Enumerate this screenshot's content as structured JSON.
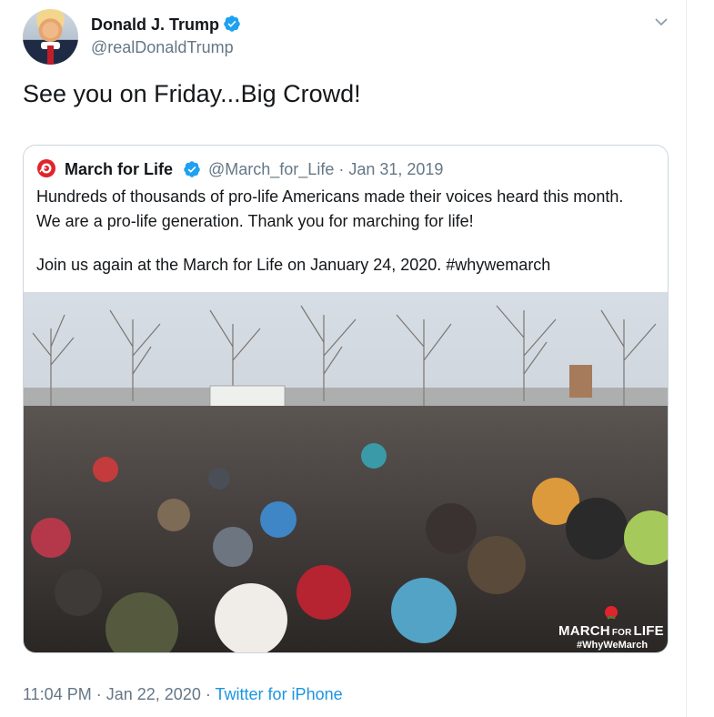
{
  "tweet": {
    "author_name": "Donald J. Trump",
    "author_handle": "@realDonaldTrump",
    "text": "See you on Friday...Big Crowd!",
    "time": "11:04 PM",
    "separator": "·",
    "date": "Jan 22, 2020",
    "source": "Twitter for iPhone",
    "menu_icon": "chevron-down-icon",
    "verified_icon": "verified-badge-icon"
  },
  "quote": {
    "author_name": "March for Life",
    "author_handle_date": "@March_for_Life · Jan 31, 2019",
    "text_lines": [
      "Hundreds of thousands of pro-life Americans made their voices heard this month.",
      "We are a pro-life generation. Thank you for marching for life!",
      "Join us again at the March for Life on January 24, 2020. #whywemarch"
    ],
    "image_overlay": {
      "brand_march": "MARCH",
      "brand_for": "FOR",
      "brand_life": "LIFE",
      "hashtag": "#WhyWeMarch"
    }
  },
  "colors": {
    "text": "#14171a",
    "secondary": "#657786",
    "link": "#1b95e0",
    "verified": "#1da1f2",
    "border": "#ccd6dd",
    "march_red": "#e0242b"
  }
}
